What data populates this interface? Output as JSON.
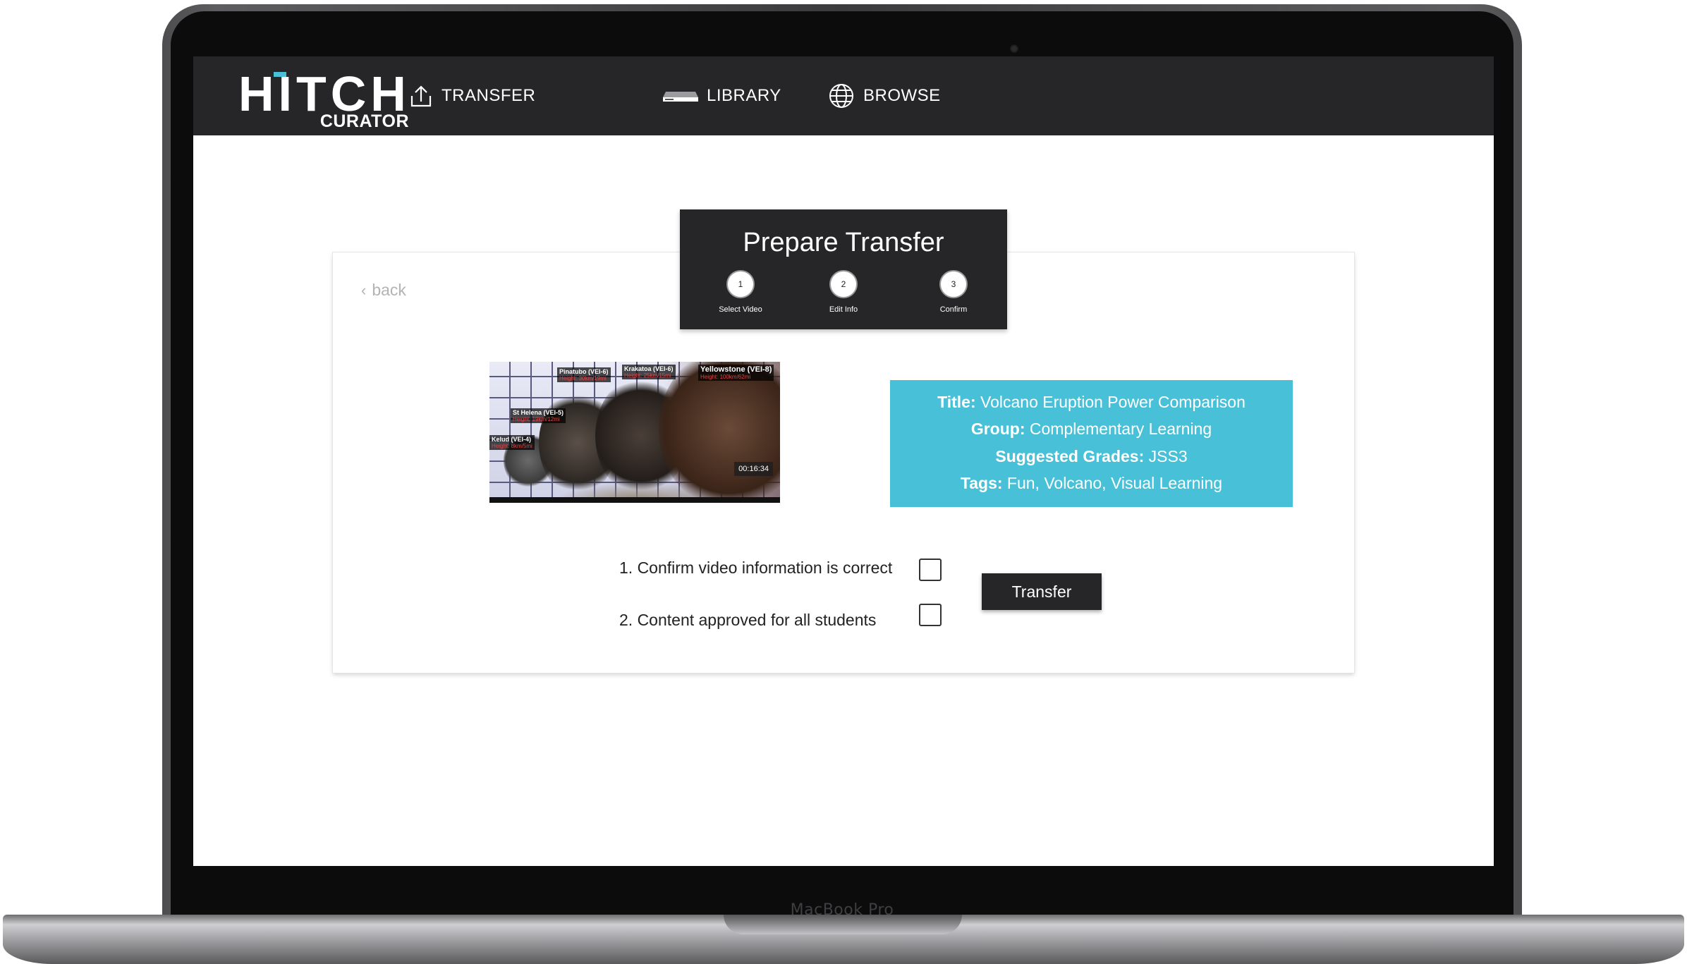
{
  "device": {
    "label": "MacBook Pro"
  },
  "app": {
    "logo_main": "HITCH",
    "logo_sub": "CURATOR"
  },
  "nav": {
    "items": [
      {
        "label": "TRANSFER",
        "icon": "upload-icon"
      },
      {
        "label": "LIBRARY",
        "icon": "hitch-device-icon"
      },
      {
        "label": "BROWSE",
        "icon": "globe-icon"
      }
    ]
  },
  "panel": {
    "back_label": "back",
    "header": {
      "title": "Prepare Transfer",
      "steps": [
        {
          "number": "1",
          "label": "Select Video"
        },
        {
          "number": "2",
          "label": "Edit Info"
        },
        {
          "number": "3",
          "label": "Confirm"
        }
      ]
    },
    "video": {
      "duration": "00:16:34",
      "labels": [
        {
          "name": "Pinatubo (VEI-6)",
          "sub": "Height: 30km/19mi"
        },
        {
          "name": "Krakatoa (VEI-6)",
          "sub": "Height: 25km/15mi"
        },
        {
          "name": "Yellowstone (VEI-8)",
          "sub": "Height: 100km/62mi"
        },
        {
          "name": "St Helena (VEI-5)",
          "sub": "Height: 19km/12mi"
        },
        {
          "name": "Kelud (VEI-4)",
          "sub": "Height: 8km/5mi"
        }
      ]
    },
    "info": {
      "title_label": "Title:",
      "title_value": "Volcano Eruption Power Comparison",
      "group_label": "Group:",
      "group_value": "Complementary Learning",
      "grades_label": "Suggested Grades:",
      "grades_value": "JSS3",
      "tags_label": "Tags:",
      "tags_value": "Fun, Volcano, Visual Learning",
      "color": "#48c0d7"
    },
    "checks": [
      {
        "label": "1. Confirm video information is correct",
        "checked": false
      },
      {
        "label": "2. Content approved for all students",
        "checked": false
      }
    ],
    "transfer_button": "Transfer"
  },
  "colors": {
    "navbar": "#262629",
    "accent": "#48c0d7",
    "button": "#262629"
  }
}
